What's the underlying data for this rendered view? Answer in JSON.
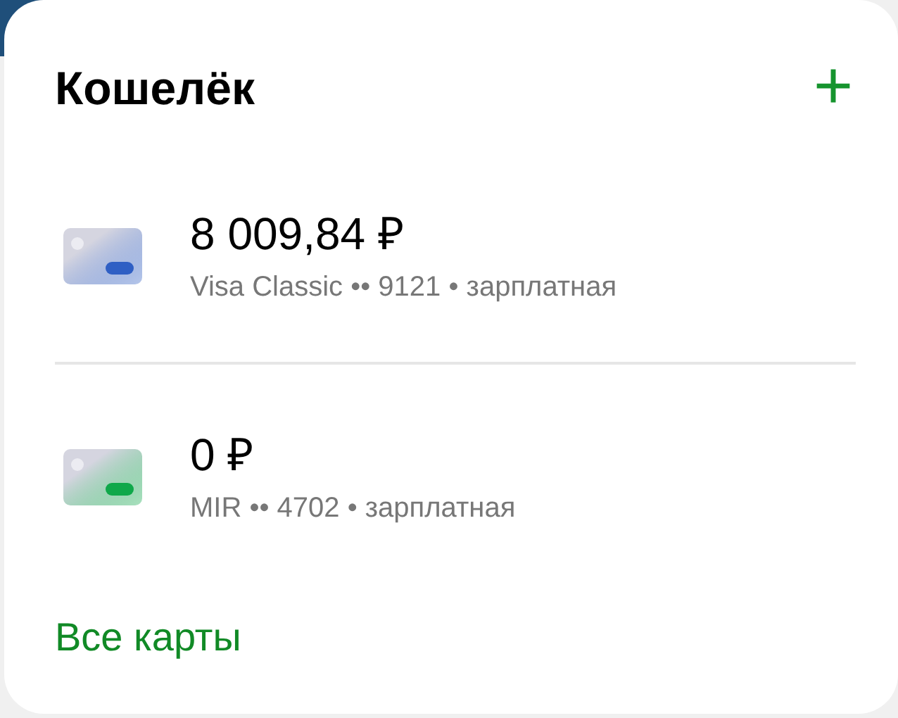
{
  "title": "Кошелёк",
  "add_button": "+",
  "cards": [
    {
      "amount": "8 009,84 ₽",
      "details": "Visa Classic •• 9121 • зарплатная",
      "color": "#2f5fc4"
    },
    {
      "amount": "0 ₽",
      "details": "MIR •• 4702 • зарплатная",
      "color": "#0fa84a"
    }
  ],
  "all_cards_link": "Все карты"
}
